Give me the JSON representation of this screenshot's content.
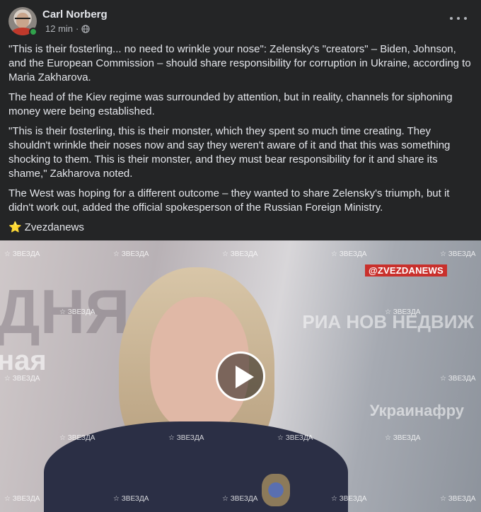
{
  "post": {
    "author": "Carl Norberg",
    "time": "12 min",
    "separator": "·",
    "paragraphs": [
      "\"This is their fosterling... no need to wrinkle your nose\": Zelensky's \"creators\" – Biden, Johnson, and the European Commission – should share responsibility for corruption in Ukraine, according to Maria Zakharova.",
      "The head of the Kiev regime was surrounded by attention, but in reality, channels for siphoning money were being established.",
      "\"This is their fosterling, this is their monster, which they spent so much time creating. They shouldn't wrinkle their noses now and say they weren't aware of it and that this was something shocking to them. This is their monster, and they must bear responsibility for it and share its shame,\" Zakharova noted.",
      "The West was hoping for a different outcome – they wanted to share Zelensky's triumph, but it didn't work out, added the official spokesperson of the Russian Foreign Ministry."
    ],
    "source_emoji": "⭐",
    "source_name": "Zvezdanews"
  },
  "video": {
    "channel_tag": "@ZVEZDANEWS",
    "watermark": "☆ ЗВЕЗДА",
    "bg_left": "ДНЯ",
    "bg_left2": "ная",
    "bg_right": "РИА НОВ НЕДВИЖ",
    "bg_right2": "Украинафру",
    "play_icon": "play-icon"
  },
  "icons": {
    "more": "more-horizontal-icon",
    "privacy": "globe-icon",
    "online": "online-status-dot"
  },
  "colors": {
    "background": "#242526",
    "text": "#e4e6eb",
    "secondary_text": "#b0b3b8",
    "online": "#31a24c",
    "channel_tag": "#c9302c"
  }
}
